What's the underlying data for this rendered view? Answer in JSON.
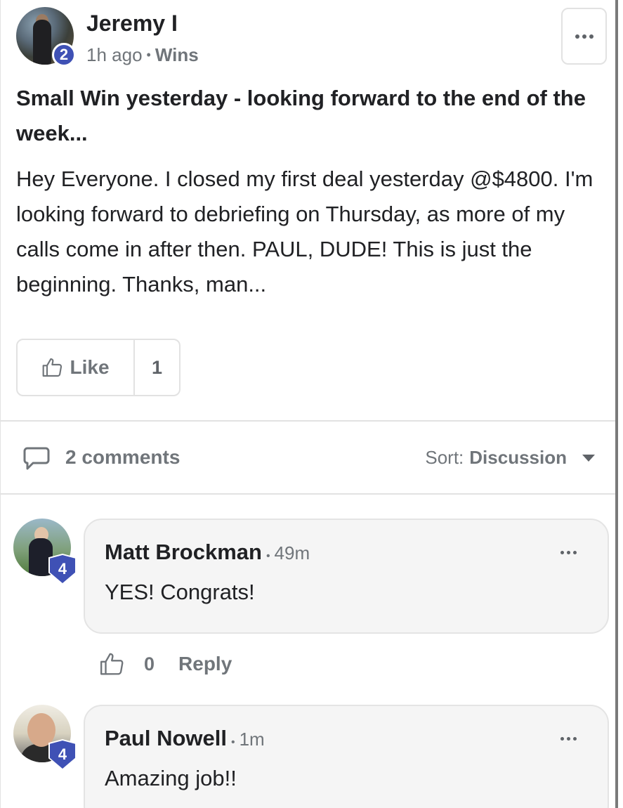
{
  "post": {
    "author": "Jeremy I",
    "author_level": "2",
    "time": "1h ago",
    "separator": "•",
    "category": "Wins",
    "title": "Small Win yesterday - looking forward to the end of the week...",
    "body": "Hey Everyone. I closed my first deal yesterday @$4800. I'm looking forward to debriefing on Thursday, as more of my calls come in after then. PAUL, DUDE! This is just the beginning. Thanks, man...",
    "like_label": "Like",
    "like_count": "1",
    "more_icon": "ellipsis-icon"
  },
  "comments_bar": {
    "count_label": "2 comments",
    "sort_label": "Sort:",
    "sort_value": "Discussion",
    "icon": "chat-bubble-icon"
  },
  "comments": [
    {
      "author": "Matt Brockman",
      "level": "4",
      "time": "49m",
      "text": "YES! Congrats!",
      "like_count": "0",
      "reply_label": "Reply"
    },
    {
      "author": "Paul Nowell",
      "level": "4",
      "time": "1m",
      "text": "Amazing job!!"
    }
  ],
  "colors": {
    "level_badge": "#3f51b5",
    "muted_text": "#70757a",
    "bubble_bg": "#f5f5f5"
  }
}
